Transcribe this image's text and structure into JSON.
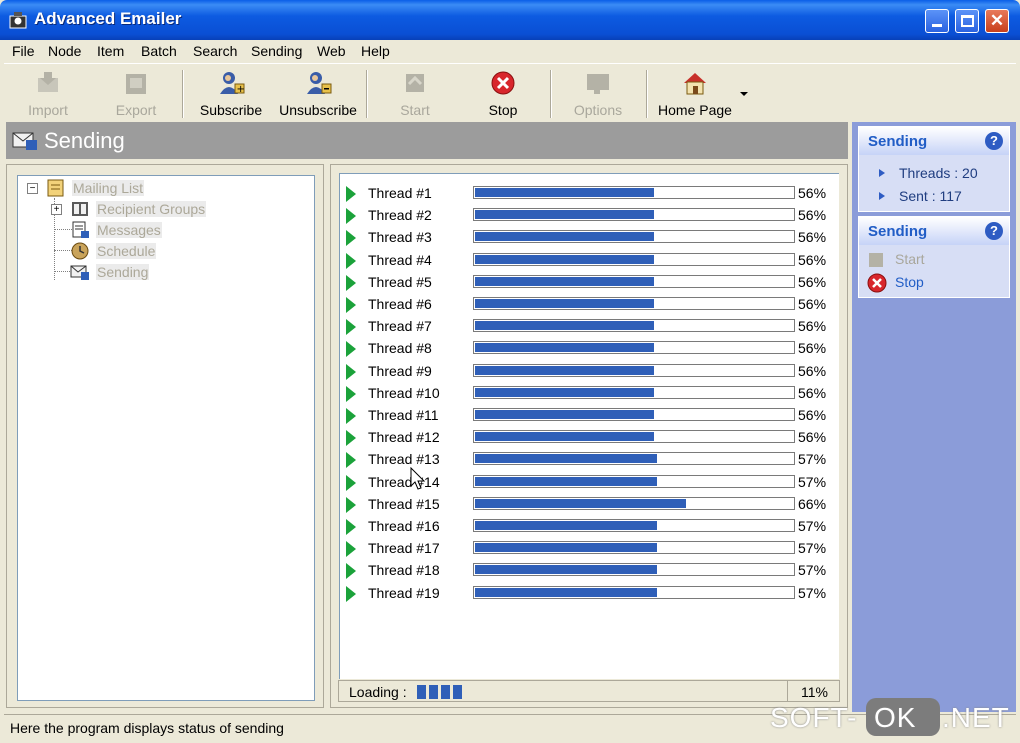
{
  "window": {
    "title": "Advanced Emailer"
  },
  "menu": [
    "File",
    "Node",
    "Item",
    "Batch",
    "Search",
    "Sending",
    "Web",
    "Help"
  ],
  "toolbar": {
    "import": "Import",
    "export": "Export",
    "subscribe": "Subscribe",
    "unsubscribe": "Unsubscribe",
    "start": "Start",
    "stop": "Stop",
    "options": "Options",
    "home_page": "Home Page"
  },
  "header": {
    "title": "Sending"
  },
  "tree": {
    "root": "Mailing List",
    "children": [
      "Recipient Groups",
      "Messages",
      "Schedule",
      "Sending"
    ]
  },
  "threads": [
    {
      "name": "Thread #1",
      "pct": "56%",
      "progress": 0.56
    },
    {
      "name": "Thread #2",
      "pct": "56%",
      "progress": 0.56
    },
    {
      "name": "Thread #3",
      "pct": "56%",
      "progress": 0.56
    },
    {
      "name": "Thread #4",
      "pct": "56%",
      "progress": 0.56
    },
    {
      "name": "Thread #5",
      "pct": "56%",
      "progress": 0.56
    },
    {
      "name": "Thread #6",
      "pct": "56%",
      "progress": 0.56
    },
    {
      "name": "Thread #7",
      "pct": "56%",
      "progress": 0.56
    },
    {
      "name": "Thread #8",
      "pct": "56%",
      "progress": 0.56
    },
    {
      "name": "Thread #9",
      "pct": "56%",
      "progress": 0.56
    },
    {
      "name": "Thread #10",
      "pct": "56%",
      "progress": 0.56
    },
    {
      "name": "Thread #11",
      "pct": "56%",
      "progress": 0.56
    },
    {
      "name": "Thread #12",
      "pct": "56%",
      "progress": 0.56
    },
    {
      "name": "Thread #13",
      "pct": "57%",
      "progress": 0.57
    },
    {
      "name": "Thread #14",
      "pct": "57%",
      "progress": 0.57
    },
    {
      "name": "Thread #15",
      "pct": "66%",
      "progress": 0.66
    },
    {
      "name": "Thread #16",
      "pct": "57%",
      "progress": 0.57
    },
    {
      "name": "Thread #17",
      "pct": "57%",
      "progress": 0.57
    },
    {
      "name": "Thread #18",
      "pct": "57%",
      "progress": 0.57
    },
    {
      "name": "Thread #19",
      "pct": "57%",
      "progress": 0.57
    }
  ],
  "loading": {
    "label": "Loading :",
    "pct": "11%",
    "progress": 0.11
  },
  "taskpanel": {
    "info": {
      "title": "Sending",
      "threads": "Threads : 20",
      "sent": "Sent : 117"
    },
    "actions": {
      "title": "Sending",
      "start": "Start",
      "stop": "Stop"
    }
  },
  "status": {
    "text": "Here the program displays status of sending"
  },
  "watermark": {
    "left": "SOFT-",
    "mid": "OK",
    "right": ".NET"
  },
  "colors": {
    "progress": "#2F5FB8",
    "title_bar": "#0A4FD4",
    "task_panel": "#8B9CD9",
    "arrow": "#1BA23A",
    "stop": "#D8262C"
  }
}
